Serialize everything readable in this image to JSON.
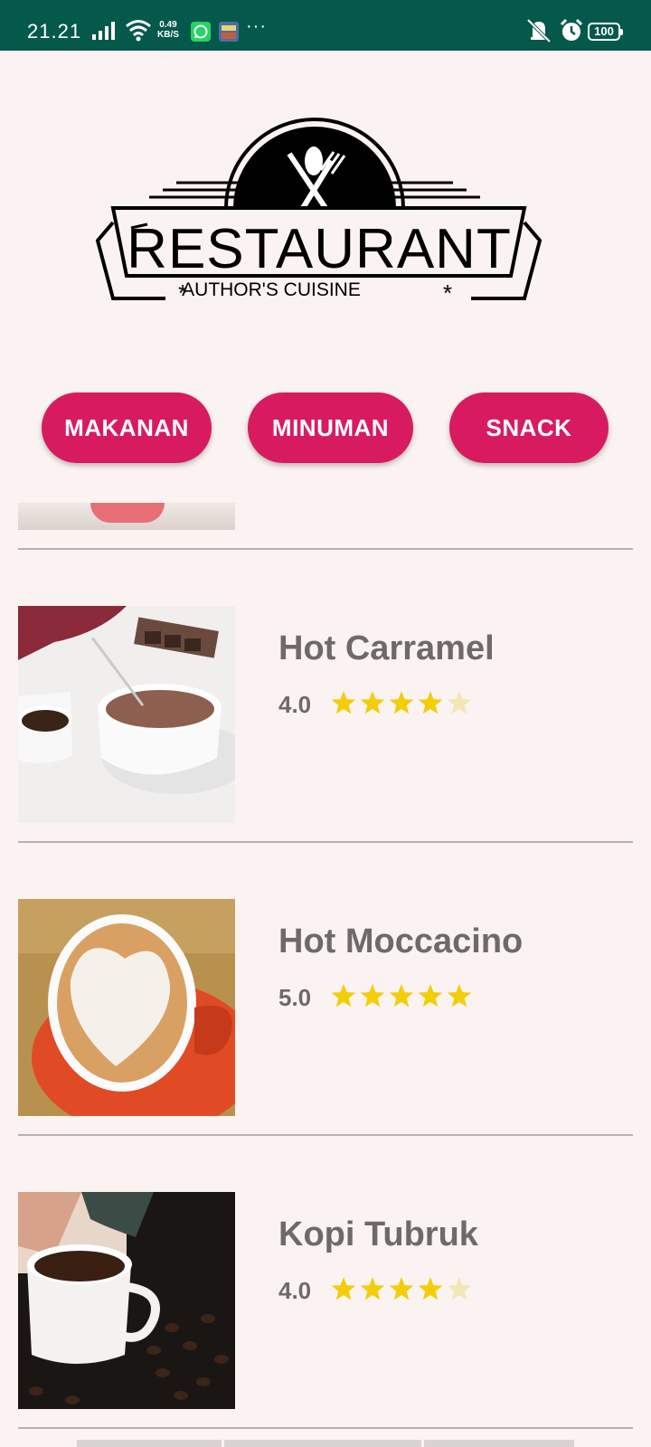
{
  "status_bar": {
    "time": "21.21",
    "speed_value": "0.49",
    "speed_unit": "KB/S",
    "dots": "···",
    "battery": "100"
  },
  "logo": {
    "title": "RESTAURANT",
    "subtitle": "AUTHOR'S CUISINE"
  },
  "categories": [
    {
      "label": "MAKANAN"
    },
    {
      "label": "MINUMAN"
    },
    {
      "label": "SNACK"
    }
  ],
  "items": [
    {
      "name": "Hot Carramel",
      "rating": "4.0",
      "stars": 4,
      "max_stars": 5
    },
    {
      "name": "Hot Moccacino",
      "rating": "5.0",
      "stars": 5,
      "max_stars": 5
    },
    {
      "name": "Kopi Tubruk",
      "rating": "4.0",
      "stars": 4,
      "max_stars": 5
    }
  ],
  "colors": {
    "status_bar": "#04594b",
    "background": "#fbf3f1",
    "accent": "#d81b60",
    "text": "#6e6a69",
    "star_filled": "#f2cd0a",
    "star_empty": "#f2e6b5"
  }
}
